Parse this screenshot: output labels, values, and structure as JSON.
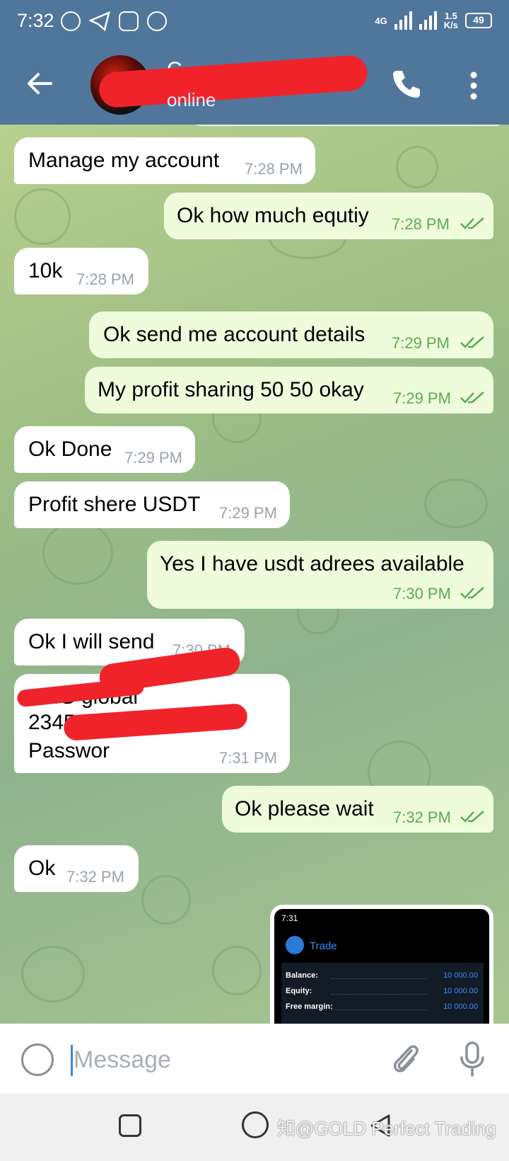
{
  "statusbar": {
    "time": "7:32",
    "network": "4G",
    "speed": "1.5",
    "speed_unit": "K/s",
    "battery": "49"
  },
  "header": {
    "contact_name": "C",
    "status": "online"
  },
  "composer": {
    "placeholder": "Message"
  },
  "watermark": "知@GOLD Perfect Trading",
  "messages": [
    {
      "dir": "in",
      "text": "Manage my account",
      "time": "7:28 PM"
    },
    {
      "dir": "out",
      "text": "Ok how much equtiy",
      "time": "7:28 PM"
    },
    {
      "dir": "in",
      "text": "10k",
      "time": "7:28 PM"
    },
    {
      "dir": "out",
      "text": "Ok send me account details",
      "time": "7:29 PM"
    },
    {
      "dir": "out",
      "text": "My profit sharing 50 50 okay",
      "time": "7:29 PM"
    },
    {
      "dir": "in",
      "text": "Ok Done",
      "time": "7:29 PM"
    },
    {
      "dir": "in",
      "text": "Profit shere USDT",
      "time": "7:29 PM"
    },
    {
      "dir": "out",
      "text": "Yes I have usdt adrees available",
      "time": "7:30 PM"
    },
    {
      "dir": "in",
      "text": "Ok I will send",
      "time": "7:30 PM"
    },
    {
      "dir": "in",
      "lines": [
        "TMG global",
        "2345",
        "Passwor"
      ],
      "time": "7:31 PM"
    },
    {
      "dir": "out",
      "text": "Ok please wait",
      "time": "7:32 PM"
    },
    {
      "dir": "in",
      "text": "Ok",
      "time": "7:32 PM"
    }
  ],
  "preview": {
    "time": "7:31",
    "title": "Trade",
    "rows": [
      {
        "label": "Balance:",
        "value": "10 000.00"
      },
      {
        "label": "Equity:",
        "value": "10 000.00"
      },
      {
        "label": "Free margin:",
        "value": "10 000.00"
      }
    ]
  },
  "colors": {
    "header": "#51769b",
    "outgoing": "#eefcdc",
    "incoming": "#ffffff",
    "tick": "#5cab52"
  }
}
